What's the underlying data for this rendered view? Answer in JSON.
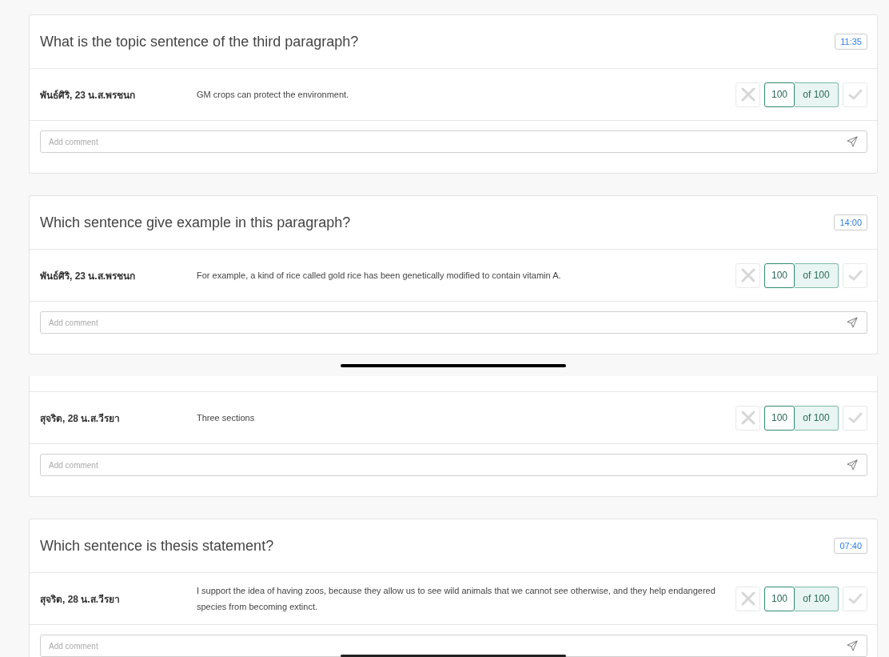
{
  "screens": [
    {
      "cards": [
        {
          "question": "What is the topic sentence of the third paragraph?",
          "timer": "11:35",
          "student": "พันธ์ศิริ, 23 น.ส.พรชนก",
          "answer": "GM crops can protect the environment.",
          "score": "100",
          "max": "of 100",
          "comment": {
            "placeholder": "Add comment"
          }
        },
        {
          "question": "Which sentence give example in this paragraph?",
          "timer": "14:00",
          "student": "พันธ์ศิริ, 23 น.ส.พรชนก",
          "answer": "For example, a kind of rice called gold rice has been genetically modified to contain vitamin A.",
          "score": "100",
          "max": "of 100",
          "comment": {
            "placeholder": "Add comment"
          }
        }
      ]
    },
    {
      "cards": [
        {
          "student": "สุจริต, 28 น.ส.วีรยา",
          "answer": "Three sections",
          "score": "100",
          "max": "of 100",
          "comment": {
            "placeholder": "Add comment"
          }
        },
        {
          "question": "Which sentence is thesis statement?",
          "timer": "07:40",
          "student": "สุจริต, 28 น.ส.วีรยา",
          "answer": "I support the idea of having zoos, because they allow us to see wild animals that we cannot see otherwise, and they help endangered species from becoming extinct.",
          "score": "100",
          "max": "of 100",
          "comment": {
            "placeholder": "Add comment"
          }
        }
      ]
    }
  ]
}
